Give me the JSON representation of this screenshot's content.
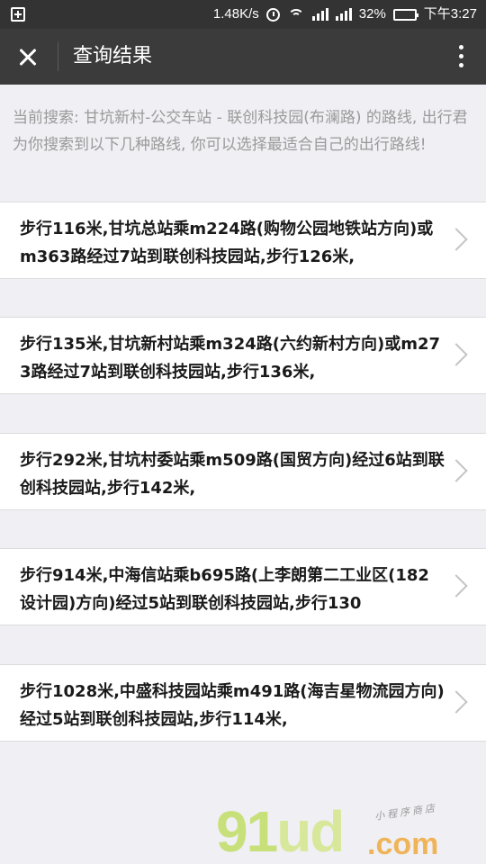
{
  "status_bar": {
    "speed": "1.48K/s",
    "battery_percent": "32%",
    "battery_level": 0.32,
    "time": "下午3:27",
    "battery_color": "#27c93f",
    "icons": [
      "notification-icon",
      "alarm-icon",
      "wifi-icon",
      "signal-icon",
      "signal-icon",
      "battery-icon"
    ]
  },
  "header": {
    "title": "查询结果",
    "close_icon": "close-icon",
    "more_icon": "more-vertical-icon"
  },
  "intro": "当前搜索: 甘坑新村-公交车站 - 联创科技园(布澜路) 的路线, 出行君为你搜索到以下几种路线, 你可以选择最适合自己的出行路线!",
  "routes": [
    {
      "text": "步行116米,甘坑总站乘m224路(购物公园地铁站方向)或m363路经过7站到联创科技园站,步行126米,"
    },
    {
      "text": "步行135米,甘坑新村站乘m324路(六约新村方向)或m273路经过7站到联创科技园站,步行136米,"
    },
    {
      "text": "步行292米,甘坑村委站乘m509路(国贸方向)经过6站到联创科技园站,步行142米,"
    },
    {
      "text": "步行914米,中海信站乘b695路(上李朗第二工业区(182设计园)方向)经过5站到联创科技园站,步行130"
    },
    {
      "text": "步行1028米,中盛科技园站乘m491路(海吉星物流园方向)经过5站到联创科技园站,步行114米,"
    }
  ],
  "watermark": {
    "brand": "91ud",
    "domain": ".com",
    "tagline": "小程序商店"
  },
  "colors": {
    "status_bar_bg": "#333333",
    "header_bg": "#3b3b3b",
    "page_bg": "#efeff4",
    "intro_text": "#9a9a9a",
    "card_bg": "#ffffff"
  }
}
